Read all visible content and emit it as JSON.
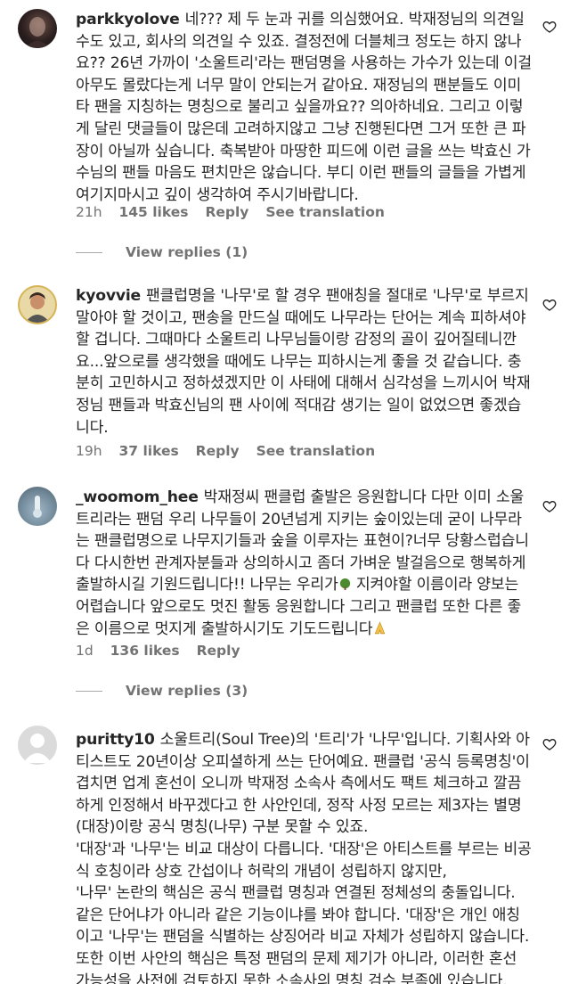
{
  "comments": [
    {
      "username": "parkkyolove",
      "text": "네??? 제 두 눈과 귀를 의심했어요. 박재정님의 의견일 수도 있고, 회사의 의견일 수 있죠. 결정전에 더블체크 정도는 하지 않나요?? 26년 가까이 '소울트리'라는 팬덤명을 사용하는 가수가 있는데 이걸 아무도 몰랐다는게 너무 말이 안되는거 같아요. 재정님의 팬분들도 이미 타 팬을 지칭하는 명칭으로 불리고 싶을까요?? 의아하네요. 그리고 이렇게 달린 댓글들이 많은데 고려하지않고 그냥 진행된다면 그거 또한 큰 파장이 아닐까 싶습니다. 축복받아 마땅한 피드에 이런 글을 쓰는 박효신 가수님의 팬들 마음도 편치만은 않습니다. 부디 이런 팬들의 글들을 가볍게 여기지마시고 깊이 생각하여 주시기바랍니다.",
      "time": "21h",
      "likes": "145 likes",
      "reply": "Reply",
      "translate": "See translation",
      "view_replies": "View replies (1)"
    },
    {
      "username": "kyovvie",
      "text": "팬클럽명을 '나무'로 할 경우 팬애칭을 절대로 '나무'로 부르지 말아야 할 것이고, 팬송을 만드실 때에도 나무라는 단어는 계속 피하셔야 할 겁니다. 그때마다 소울트리 나무님들이랑 감정의 골이 깊어질테니깐요...앞으로를 생각했을 때에도 나무는 피하시는게 좋을 것 같습니다. 충분히 고민하시고 정하셨겠지만 이 사태에 대해서 심각성을 느끼시어 박재정님 팬들과 박효신님의 팬 사이에 적대감 생기는 일이 없었으면 좋겠습니다.",
      "time": "19h",
      "likes": "37 likes",
      "reply": "Reply",
      "translate": "See translation"
    },
    {
      "username": "_woomom_hee",
      "text_before_emoji": "박재정씨 팬클럽 출발은 응원합니다 다만 이미 소울트리라는 팬덤 우리 나무들이 20년넘게 지키는 숲이있는데 굳이 나무라는 팬클럽명으로 나무지기들과 숲을 이루자는 표현이?너무 당황스럽습니다 다시한번 관계자분들과 상의하시고 좀더 가벼운 발걸음으로 행복하게 출발하시길 기원드립니다!! 나무는 우리가",
      "text_after_emoji": " 지켜야할 이름이라 양보는 어렵습니다 앞으로도 멋진 활동 응원합니다 그리고 팬클럽 또한 다른 좋은 이름으로 멋지게 출발하시기도 기도드립니다",
      "time": "1d",
      "likes": "136 likes",
      "reply": "Reply",
      "view_replies": "View replies (3)"
    },
    {
      "username": "puritty10",
      "para1": "소울트리(Soul Tree)의 '트리'가 '나무'입니다. 기획사와 아티스트도 20년이상 오피셜하게 쓰는 단어예요. 팬클럽 '공식 등록명칭'이 겹치면 업계 혼선이 오니까 박재정 소속사 측에서도 팩트 체크하고 깔끔하게 인정해서 바꾸겠다고 한 사안인데, 정작 사정 모르는 제3자는 별명(대장)이랑 공식 명칭(나무) 구분 못할 수 있죠.",
      "para2": "'대장'과 '나무'는 비교 대상이 다릅니다. '대장'은 아티스트를 부르는 비공식 호칭이라 상호 간섭이나 허락의 개념이 성립하지 않지만,",
      "para3": "'나무' 논란의 핵심은 공식 팬클럽 명칭과 연결된 정체성의 충돌입니다. 같은 단어냐가 아니라 같은 기능이냐를 봐야 합니다. '대장'은 개인 애칭이고 '나무'는 팬덤을 식별하는 상징어라 비교 자체가 성립하지 않습니다. 또한 이번 사안의 핵심은 특정 팬덤의 문제 제기가 아니라, 이러한 혼선 가능성을 사전에 검토하지 못한 소속사의 명칭 검수 부족에 있습니다."
    }
  ]
}
